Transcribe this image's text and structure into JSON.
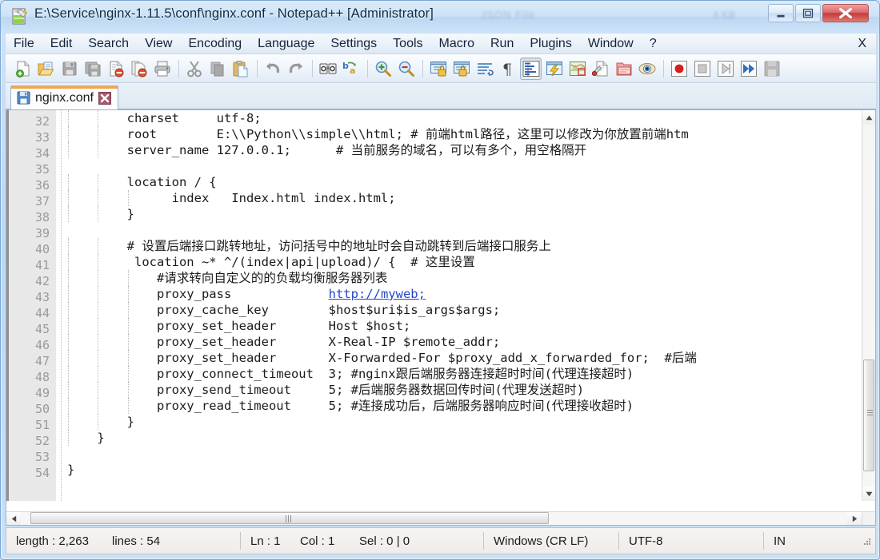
{
  "window": {
    "title": "E:\\Service\\nginx-1.11.5\\conf\\nginx.conf - Notepad++ [Administrator]",
    "ghost_text_1": "JSON File",
    "ghost_text_2": "4 KB",
    "icon": "notepad-plus-plus-icon",
    "minimize_label": "Minimize",
    "maximize_label": "Maximize",
    "close_label": "Close"
  },
  "menu": {
    "items": [
      {
        "label": "File",
        "name": "menu-file"
      },
      {
        "label": "Edit",
        "name": "menu-edit"
      },
      {
        "label": "Search",
        "name": "menu-search"
      },
      {
        "label": "View",
        "name": "menu-view"
      },
      {
        "label": "Encoding",
        "name": "menu-encoding"
      },
      {
        "label": "Language",
        "name": "menu-language"
      },
      {
        "label": "Settings",
        "name": "menu-settings"
      },
      {
        "label": "Tools",
        "name": "menu-tools"
      },
      {
        "label": "Macro",
        "name": "menu-macro"
      },
      {
        "label": "Run",
        "name": "menu-run"
      },
      {
        "label": "Plugins",
        "name": "menu-plugins"
      },
      {
        "label": "Window",
        "name": "menu-window"
      },
      {
        "label": "?",
        "name": "menu-help"
      }
    ],
    "close_document_label": "X"
  },
  "toolbar": {
    "buttons": [
      {
        "name": "new-file-icon",
        "title": "New"
      },
      {
        "name": "open-file-icon",
        "title": "Open"
      },
      {
        "name": "save-icon",
        "title": "Save"
      },
      {
        "name": "save-all-icon",
        "title": "Save All"
      },
      {
        "name": "close-file-icon",
        "title": "Close"
      },
      {
        "name": "close-all-files-icon",
        "title": "Close All"
      },
      {
        "name": "print-icon",
        "title": "Print"
      },
      {
        "name": "cut-icon",
        "title": "Cut"
      },
      {
        "name": "copy-icon",
        "title": "Copy"
      },
      {
        "name": "paste-icon",
        "title": "Paste"
      },
      {
        "name": "undo-icon",
        "title": "Undo"
      },
      {
        "name": "redo-icon",
        "title": "Redo"
      },
      {
        "name": "find-icon",
        "title": "Find"
      },
      {
        "name": "replace-icon",
        "title": "Replace"
      },
      {
        "name": "zoom-in-icon",
        "title": "Zoom In"
      },
      {
        "name": "zoom-out-icon",
        "title": "Zoom Out"
      },
      {
        "name": "sync-vertical-scroll-icon",
        "title": "Synchronize Vertical Scrolling"
      },
      {
        "name": "sync-horizontal-scroll-icon",
        "title": "Synchronize Horizontal Scrolling"
      },
      {
        "name": "word-wrap-icon",
        "title": "Word wrap"
      },
      {
        "name": "show-all-characters-icon",
        "title": "Show All Characters"
      },
      {
        "name": "indent-guideline-icon",
        "title": "Show Indent Guide"
      },
      {
        "name": "user-defined-dialog-icon",
        "title": "Show User Defined Dialogue"
      },
      {
        "name": "document-map-icon",
        "title": "Document Map"
      },
      {
        "name": "function-list-icon",
        "title": "Function List"
      },
      {
        "name": "folder-as-workspace-icon",
        "title": "Folder as Workspace"
      },
      {
        "name": "monitoring-eye-icon",
        "title": "Monitoring (tail -f)"
      },
      {
        "name": "record-macro-icon",
        "title": "Start Recording"
      },
      {
        "name": "stop-recording-icon",
        "title": "Stop Recording"
      },
      {
        "name": "play-macro-icon",
        "title": "Playback"
      },
      {
        "name": "run-macro-multiple-icon",
        "title": "Run a Macro Multiple Times"
      },
      {
        "name": "save-macro-icon",
        "title": "Save Current Recorded Macro"
      }
    ]
  },
  "tabs": [
    {
      "label": "nginx.conf",
      "icon": "saved-file-icon",
      "close_icon": "tab-close-icon",
      "active": true
    }
  ],
  "editor": {
    "first_line_number": 32,
    "lines": [
      {
        "n": 32,
        "segments": [
          {
            "t": "        charset     utf-8;"
          }
        ]
      },
      {
        "n": 33,
        "segments": [
          {
            "t": "        root        E:\\\\Python\\\\simple\\\\html; # 前端html路径，这里可以修改为你放置前端htm"
          }
        ]
      },
      {
        "n": 34,
        "segments": [
          {
            "t": "        server_name 127.0.0.1;      # 当前服务的域名，可以有多个，用空格隔开"
          }
        ]
      },
      {
        "n": 35,
        "segments": [
          {
            "t": ""
          }
        ]
      },
      {
        "n": 36,
        "segments": [
          {
            "t": "        location / {"
          }
        ]
      },
      {
        "n": 37,
        "segments": [
          {
            "t": "              index   Index.html index.html;"
          }
        ]
      },
      {
        "n": 38,
        "segments": [
          {
            "t": "        }"
          }
        ]
      },
      {
        "n": 39,
        "segments": [
          {
            "t": ""
          }
        ]
      },
      {
        "n": 40,
        "segments": [
          {
            "t": "        # 设置后端接口跳转地址，访问括号中的地址时会自动跳转到后端接口服务上"
          }
        ]
      },
      {
        "n": 41,
        "segments": [
          {
            "t": "         location ~* ^/(index|api|upload)/ {  # 这里设置"
          }
        ]
      },
      {
        "n": 42,
        "segments": [
          {
            "t": "            #请求转向自定义的的负载均衡服务器列表"
          }
        ]
      },
      {
        "n": 43,
        "segments": [
          {
            "t": "            proxy_pass             "
          },
          {
            "t": "http://myweb;",
            "link": true
          }
        ]
      },
      {
        "n": 44,
        "segments": [
          {
            "t": "            proxy_cache_key        $host$uri$is_args$args;"
          }
        ]
      },
      {
        "n": 45,
        "segments": [
          {
            "t": "            proxy_set_header       Host $host;"
          }
        ]
      },
      {
        "n": 46,
        "segments": [
          {
            "t": "            proxy_set_header       X-Real-IP $remote_addr;"
          }
        ]
      },
      {
        "n": 47,
        "segments": [
          {
            "t": "            proxy_set_header       X-Forwarded-For $proxy_add_x_forwarded_for;  #后端"
          }
        ]
      },
      {
        "n": 48,
        "segments": [
          {
            "t": "            proxy_connect_timeout  3; #nginx跟后端服务器连接超时时间(代理连接超时)"
          }
        ]
      },
      {
        "n": 49,
        "segments": [
          {
            "t": "            proxy_send_timeout     5; #后端服务器数据回传时间(代理发送超时)"
          }
        ]
      },
      {
        "n": 50,
        "segments": [
          {
            "t": "            proxy_read_timeout     5; #连接成功后，后端服务器响应时间(代理接收超时)"
          }
        ]
      },
      {
        "n": 51,
        "segments": [
          {
            "t": "        }"
          }
        ]
      },
      {
        "n": 52,
        "segments": [
          {
            "t": "    }"
          }
        ]
      },
      {
        "n": 53,
        "segments": [
          {
            "t": ""
          }
        ]
      },
      {
        "n": 54,
        "segments": [
          {
            "t": "}"
          }
        ]
      }
    ],
    "link_color": "#2547c8"
  },
  "status": {
    "length_label": "length : 2,263",
    "lines_label": "lines : 54",
    "ln_label": "Ln : 1",
    "col_label": "Col : 1",
    "sel_label": "Sel : 0 | 0",
    "eol_label": "Windows (CR LF)",
    "encoding_label": "UTF-8",
    "insert_mode_label": "IN"
  }
}
